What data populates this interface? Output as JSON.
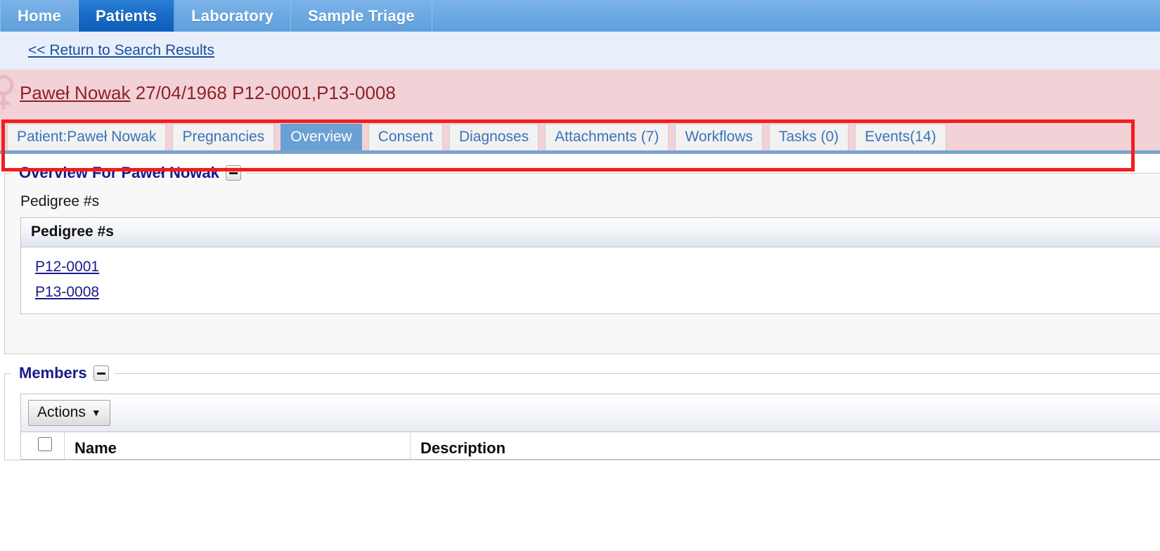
{
  "nav": {
    "items": [
      {
        "label": "Home",
        "active": false
      },
      {
        "label": "Patients",
        "active": true
      },
      {
        "label": "Laboratory",
        "active": false
      },
      {
        "label": "Sample Triage",
        "active": false
      }
    ]
  },
  "return_link": {
    "label": "<< Return to Search Results"
  },
  "patient_banner": {
    "gender_icon": "female-symbol-icon",
    "name": "Paweł Nowak",
    "details": "27/04/1968 P12-0001,P13-0008",
    "birth_date": "27/04/1968",
    "pedigree_ids": "P12-0001,P13-0008",
    "background_color": "#f2d2d7",
    "text_color": "#8c2328"
  },
  "tabs": [
    {
      "label": "Patient:Paweł Nowak",
      "active": false
    },
    {
      "label": "Pregnancies",
      "active": false
    },
    {
      "label": "Overview",
      "active": true
    },
    {
      "label": "Consent",
      "active": false
    },
    {
      "label": "Diagnoses",
      "active": false
    },
    {
      "label": "Attachments (7)",
      "active": false
    },
    {
      "label": "Workflows",
      "active": false
    },
    {
      "label": "Tasks (0)",
      "active": false
    },
    {
      "label": "Events(14)",
      "active": false
    }
  ],
  "annotation": {
    "shape": "rectangle",
    "color": "#f41d1d",
    "target": "patient-tab-strip"
  },
  "overview_panel": {
    "legend": "Overview For Paweł Nowak",
    "collapse_label": "−",
    "field_label": "Pedigree #s",
    "grid": {
      "header": "Pedigree #s",
      "rows": [
        "P12-0001",
        "P13-0008"
      ]
    }
  },
  "members_panel": {
    "legend": "Members",
    "collapse_label": "−",
    "toolbar": {
      "actions_label": "Actions",
      "caret": "▼"
    },
    "columns": [
      "Name",
      "Description"
    ]
  },
  "colors": {
    "nav_active": "#1769c4",
    "nav_bg": "#6aa8e2",
    "tab_active": "#6aa0d4",
    "link": "#1a1a8c",
    "legend": "#1a1a8c",
    "banner": "#f2d2d7",
    "annotation": "#f41d1d"
  }
}
